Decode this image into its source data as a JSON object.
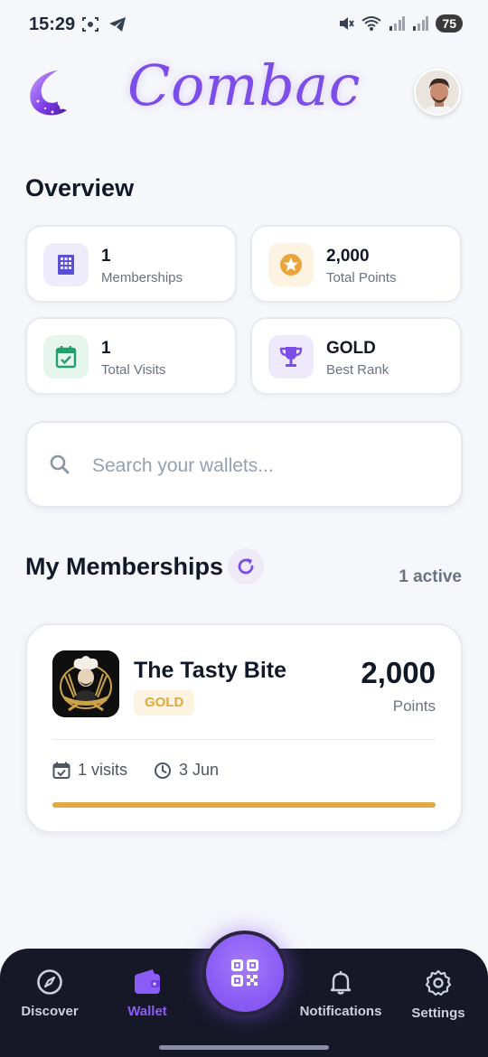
{
  "status_bar": {
    "time": "15:29",
    "battery": "75"
  },
  "header": {
    "app_title": "Combac"
  },
  "overview": {
    "title": "Overview",
    "stats": [
      {
        "value": "1",
        "label": "Memberships",
        "icon": "building-icon",
        "color": "#5b4fd6",
        "bg": "#eeecfb"
      },
      {
        "value": "2,000",
        "label": "Total Points",
        "icon": "star-coin-icon",
        "color": "#e9a43b",
        "bg": "#fdf3e3"
      },
      {
        "value": "1",
        "label": "Total Visits",
        "icon": "calendar-check-icon",
        "color": "#22a06b",
        "bg": "#e6f6ee"
      },
      {
        "value": "GOLD",
        "label": "Best Rank",
        "icon": "trophy-icon",
        "color": "#7c4de8",
        "bg": "#efeafb"
      }
    ]
  },
  "search": {
    "placeholder": "Search your wallets..."
  },
  "memberships": {
    "title": "My Memberships",
    "active_count": "1 active",
    "items": [
      {
        "name": "The Tasty Bite",
        "rank": "GOLD",
        "points": "2,000",
        "points_label": "Points",
        "visits": "1 visits",
        "date": "3 Jun",
        "progress": 1.0
      }
    ]
  },
  "nav": {
    "items": [
      {
        "label": "Discover",
        "icon": "compass-icon",
        "active": false
      },
      {
        "label": "Wallet",
        "icon": "wallet-icon",
        "active": true
      },
      {
        "label": "Notifications",
        "icon": "bell-icon",
        "active": false
      },
      {
        "label": "Settings",
        "icon": "gear-icon",
        "active": false
      }
    ],
    "scan_icon": "qr-code-icon"
  },
  "colors": {
    "accent": "#7c4de8",
    "gold": "#e1a844",
    "nav_bg": "#161828"
  }
}
